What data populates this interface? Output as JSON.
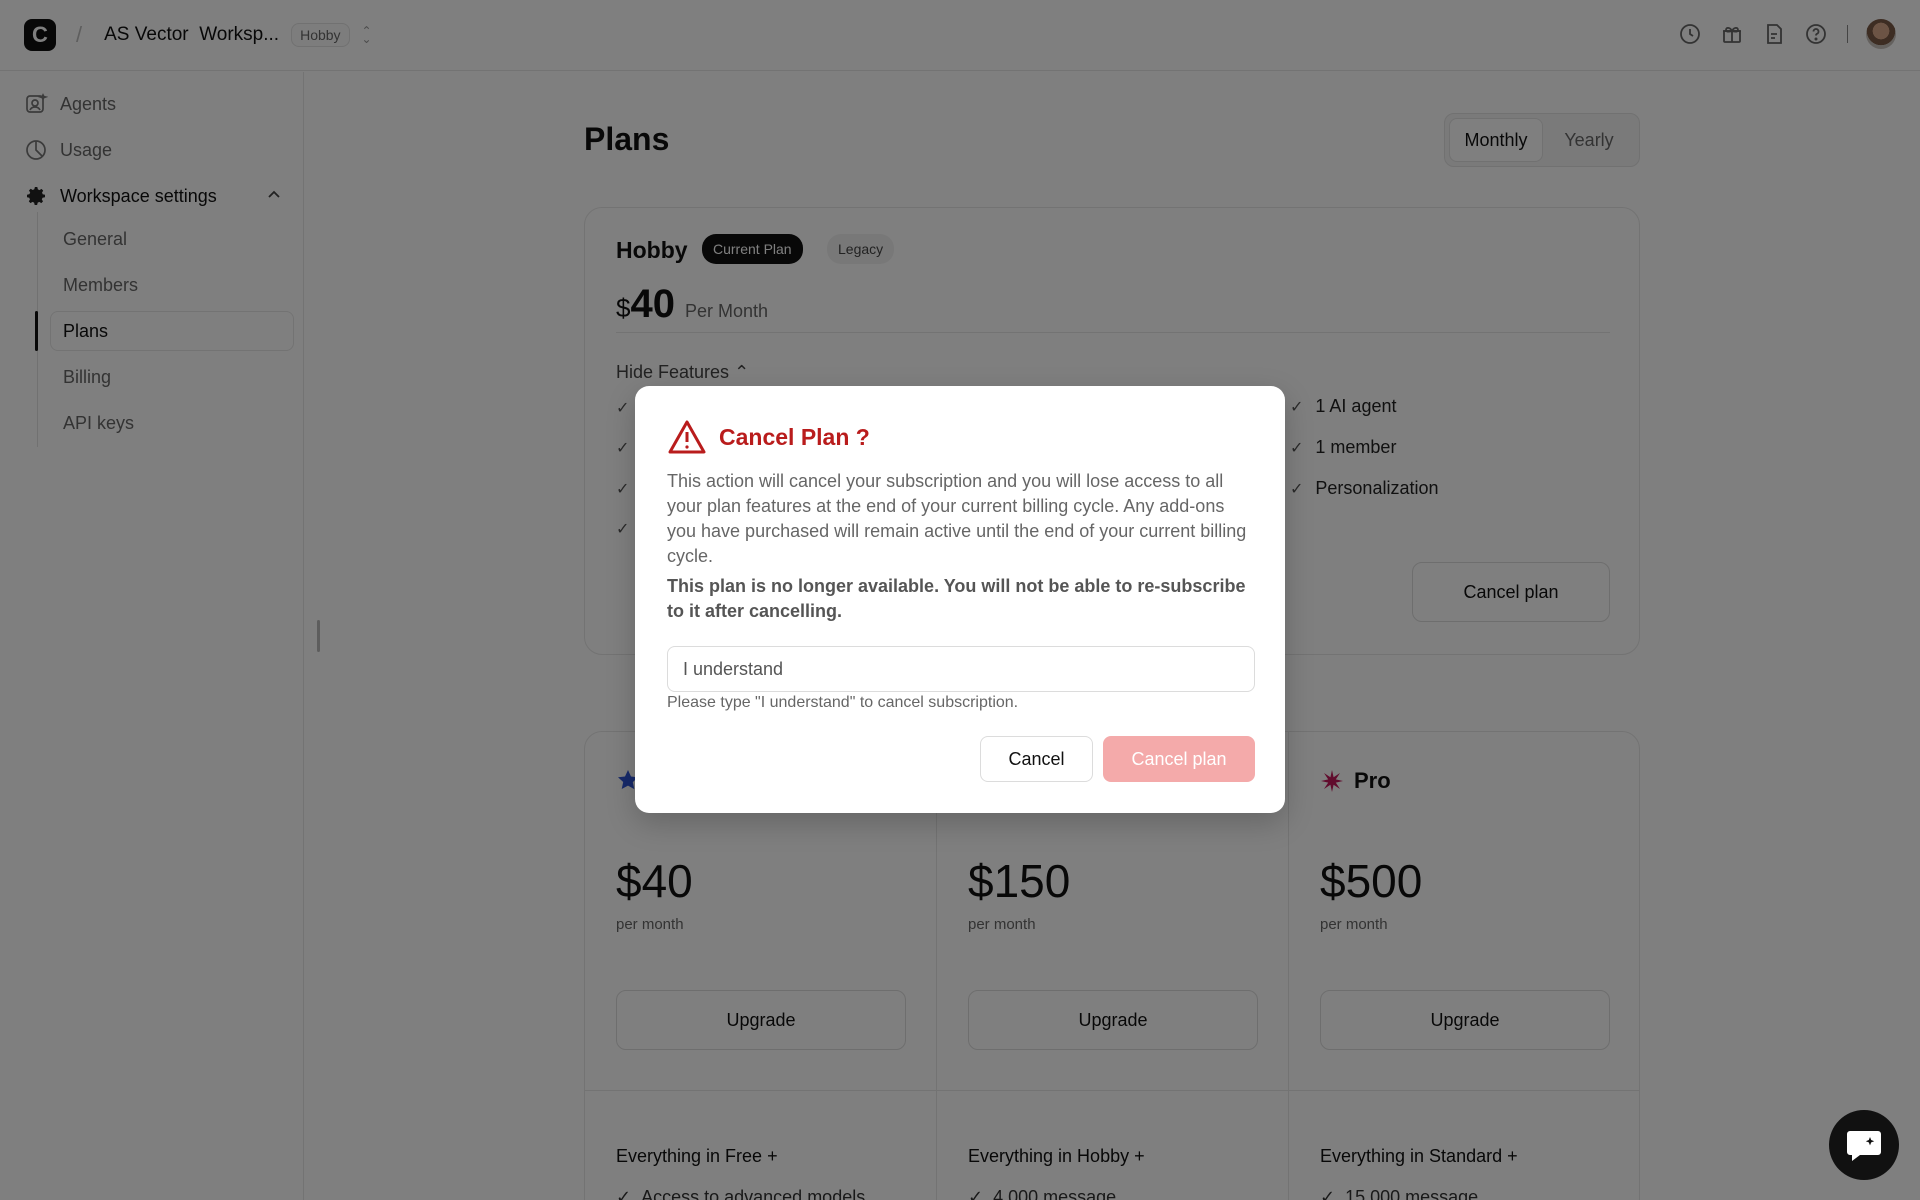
{
  "header": {
    "workspace_name": "AS Vector",
    "workspace_label": "Worksp...",
    "plan_badge": "Hobby",
    "logo_letter": "C",
    "icons": [
      "history-icon",
      "gift-icon",
      "changelog-icon",
      "help-icon",
      "avatar"
    ]
  },
  "sidebar": {
    "items": [
      {
        "label": "Agents",
        "icon": "agent-icon"
      },
      {
        "label": "Usage",
        "icon": "usage-icon"
      },
      {
        "label": "Workspace settings",
        "icon": "gear-icon"
      }
    ],
    "sub_items": [
      {
        "label": "General"
      },
      {
        "label": "Members"
      },
      {
        "label": "Plans",
        "active": true
      },
      {
        "label": "Billing"
      },
      {
        "label": "API keys"
      }
    ]
  },
  "main": {
    "title": "Plans",
    "billing_toggle": {
      "options": [
        "Monthly",
        "Yearly"
      ],
      "selected": "Monthly"
    },
    "current_plan": {
      "name": "Hobby",
      "badge_current": "Current Plan",
      "badge_legacy": "Legacy",
      "currency": "$",
      "price": "40",
      "period": "Per Month",
      "toggle_features": "Hide Features",
      "features": [
        "1 AI agent",
        "1 member",
        "Personalization"
      ],
      "cancel_label": "Cancel plan"
    },
    "plans": [
      {
        "name": "",
        "icon": "star-icon",
        "price": "$40",
        "per": "per month",
        "button": "Upgrade",
        "everything": "Everything in Free +",
        "first_feature": "Access to advanced models"
      },
      {
        "name": "",
        "icon": "",
        "price": "$150",
        "per": "per month",
        "button": "Upgrade",
        "everything": "Everything in Hobby +",
        "first_feature": "4,000 message"
      },
      {
        "name": "Pro",
        "icon": "burst-icon",
        "price": "$500",
        "per": "per month",
        "button": "Upgrade",
        "everything": "Everything in Standard +",
        "first_feature": "15,000 message"
      }
    ]
  },
  "modal": {
    "title": "Cancel Plan ?",
    "description": "This action will cancel your subscription and you will lose access to all your plan features at the end of your current billing cycle. Any add-ons you have purchased will remain active until the end of your current billing cycle.",
    "warning": "This plan is no longer available. You will not be able to re-subscribe to it after cancelling.",
    "input_value": "I understand",
    "hint": "Please type \"I understand\" to cancel subscription.",
    "cancel_label": "Cancel",
    "confirm_label": "Cancel plan"
  },
  "colors": {
    "danger": "#b91c1c",
    "confirm_disabled": "#f4aaaa",
    "star": "#2f55d4",
    "burst": "#c2185b"
  }
}
